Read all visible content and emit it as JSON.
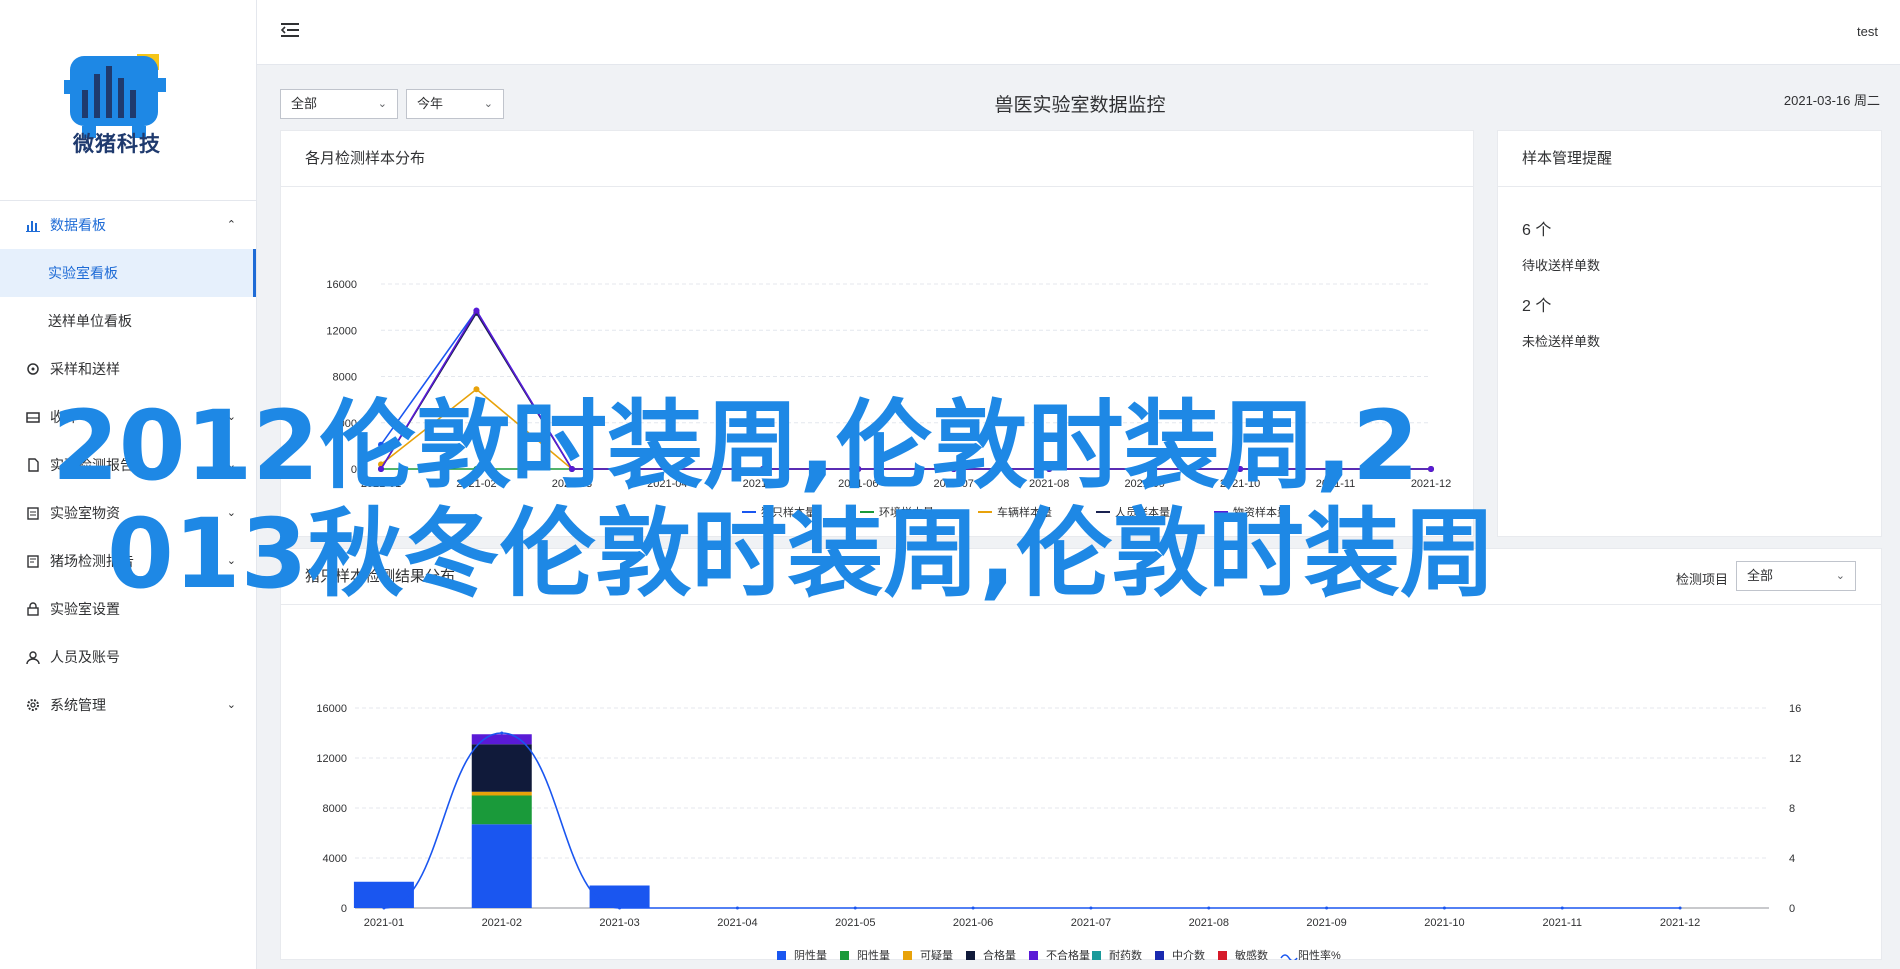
{
  "brand": {
    "name": "微猪科技"
  },
  "sidebar": {
    "items": [
      {
        "label": "数据看板",
        "icon": "bar-chart-icon"
      },
      {
        "label": "实验室看板"
      },
      {
        "label": "送样单位看板"
      },
      {
        "label": "采样和送样",
        "icon": "tag-icon"
      },
      {
        "label": "收样",
        "icon": "inbox-icon"
      },
      {
        "label": "实验检测报告",
        "icon": "document-icon"
      },
      {
        "label": "实验室物资",
        "icon": "clipboard-icon"
      },
      {
        "label": "猪场检测报告",
        "icon": "report-icon"
      },
      {
        "label": "实验室设置",
        "icon": "lock-icon"
      },
      {
        "label": "人员及账号",
        "icon": "user-icon"
      },
      {
        "label": "系统管理",
        "icon": "gear-icon"
      }
    ]
  },
  "topbar": {
    "user": "test"
  },
  "filters": {
    "range": "全部",
    "period": "今年"
  },
  "page": {
    "title": "兽医实验室数据监控",
    "date": "2021-03-16 周二"
  },
  "monthly_card": {
    "title": "各月检测样本分布"
  },
  "sample_card": {
    "title": "样本管理提醒",
    "stats": [
      {
        "value": "6 个",
        "label": "待收送样单数"
      },
      {
        "value": "2 个",
        "label": "未检送样单数"
      }
    ]
  },
  "result_card": {
    "title": "猪只样本检测结果分布",
    "filter_label": "检测项目",
    "filter_value": "全部"
  },
  "overlay": {
    "line1": "2012伦敦时装周,伦敦时装周,2",
    "line2": "013秋冬伦敦时装周,伦敦时装周"
  },
  "chart_data": [
    {
      "type": "line",
      "title": "各月检测样本分布",
      "x": [
        "2021-01",
        "2021-02",
        "2021-03",
        "2021-04",
        "2021-05",
        "2021-06",
        "2021-07",
        "2021-08",
        "2021-09",
        "2021-10",
        "2021-11",
        "2021-12"
      ],
      "ylim": [
        0,
        16000
      ],
      "yticks": [
        0,
        4000,
        8000,
        12000,
        16000
      ],
      "grid": true,
      "legend_position": "bottom",
      "series": [
        {
          "name": "猪只样本量",
          "color": "#1a56f0",
          "values": [
            2100,
            13700,
            0,
            0,
            0,
            0,
            0,
            0,
            0,
            0,
            0,
            0
          ]
        },
        {
          "name": "环境样本量",
          "color": "#1a9a3a",
          "values": [
            0,
            0,
            0,
            0,
            0,
            0,
            0,
            0,
            0,
            0,
            0,
            0
          ]
        },
        {
          "name": "车辆样本量",
          "color": "#e8a20a",
          "values": [
            400,
            6900,
            0,
            0,
            0,
            0,
            0,
            0,
            0,
            0,
            0,
            0
          ]
        },
        {
          "name": "人员样本量",
          "color": "#1a2250",
          "values": [
            0,
            13500,
            0,
            0,
            0,
            0,
            0,
            0,
            0,
            0,
            0,
            0
          ]
        },
        {
          "name": "物资样本量",
          "color": "#5a1ad6",
          "values": [
            0,
            13700,
            0,
            0,
            0,
            0,
            0,
            0,
            0,
            0,
            0,
            0
          ]
        }
      ]
    },
    {
      "type": "bar",
      "title": "猪只样本检测结果分布",
      "categories": [
        "2021-01",
        "2021-02",
        "2021-03",
        "2021-04",
        "2021-05",
        "2021-06",
        "2021-07",
        "2021-08",
        "2021-09",
        "2021-10",
        "2021-11",
        "2021-12"
      ],
      "ylim": [
        0,
        16000
      ],
      "yticks": [
        0,
        4000,
        8000,
        12000,
        16000
      ],
      "y2lim": [
        0,
        16
      ],
      "y2ticks": [
        0,
        4,
        8,
        12,
        16
      ],
      "stacked": true,
      "grid": true,
      "legend_position": "bottom",
      "series": [
        {
          "name": "阴性量",
          "color": "#1a56f0",
          "values": [
            2100,
            6700,
            1800,
            0,
            0,
            0,
            0,
            0,
            0,
            0,
            0,
            0
          ]
        },
        {
          "name": "阳性量",
          "color": "#1a9a3a",
          "values": [
            0,
            2300,
            0,
            0,
            0,
            0,
            0,
            0,
            0,
            0,
            0,
            0
          ]
        },
        {
          "name": "可疑量",
          "color": "#e8a20a",
          "values": [
            0,
            300,
            0,
            0,
            0,
            0,
            0,
            0,
            0,
            0,
            0,
            0
          ]
        },
        {
          "name": "合格量",
          "color": "#101a3a",
          "values": [
            0,
            3800,
            0,
            0,
            0,
            0,
            0,
            0,
            0,
            0,
            0,
            0
          ]
        },
        {
          "name": "不合格量",
          "color": "#5a1ad6",
          "values": [
            0,
            800,
            0,
            0,
            0,
            0,
            0,
            0,
            0,
            0,
            0,
            0
          ]
        },
        {
          "name": "耐药数",
          "color": "#1a9a9a",
          "values": [
            0,
            0,
            0,
            0,
            0,
            0,
            0,
            0,
            0,
            0,
            0,
            0
          ]
        },
        {
          "name": "中介数",
          "color": "#1a2ab0",
          "values": [
            0,
            0,
            0,
            0,
            0,
            0,
            0,
            0,
            0,
            0,
            0,
            0
          ]
        },
        {
          "name": "敏感数",
          "color": "#d61a2a",
          "values": [
            0,
            0,
            0,
            0,
            0,
            0,
            0,
            0,
            0,
            0,
            0,
            0
          ]
        }
      ],
      "line_series": {
        "name": "阳性率%",
        "color": "#1a56f0",
        "axis": "right",
        "values": [
          0,
          14,
          0,
          0,
          0,
          0,
          0,
          0,
          0,
          0,
          0,
          0
        ]
      }
    }
  ]
}
